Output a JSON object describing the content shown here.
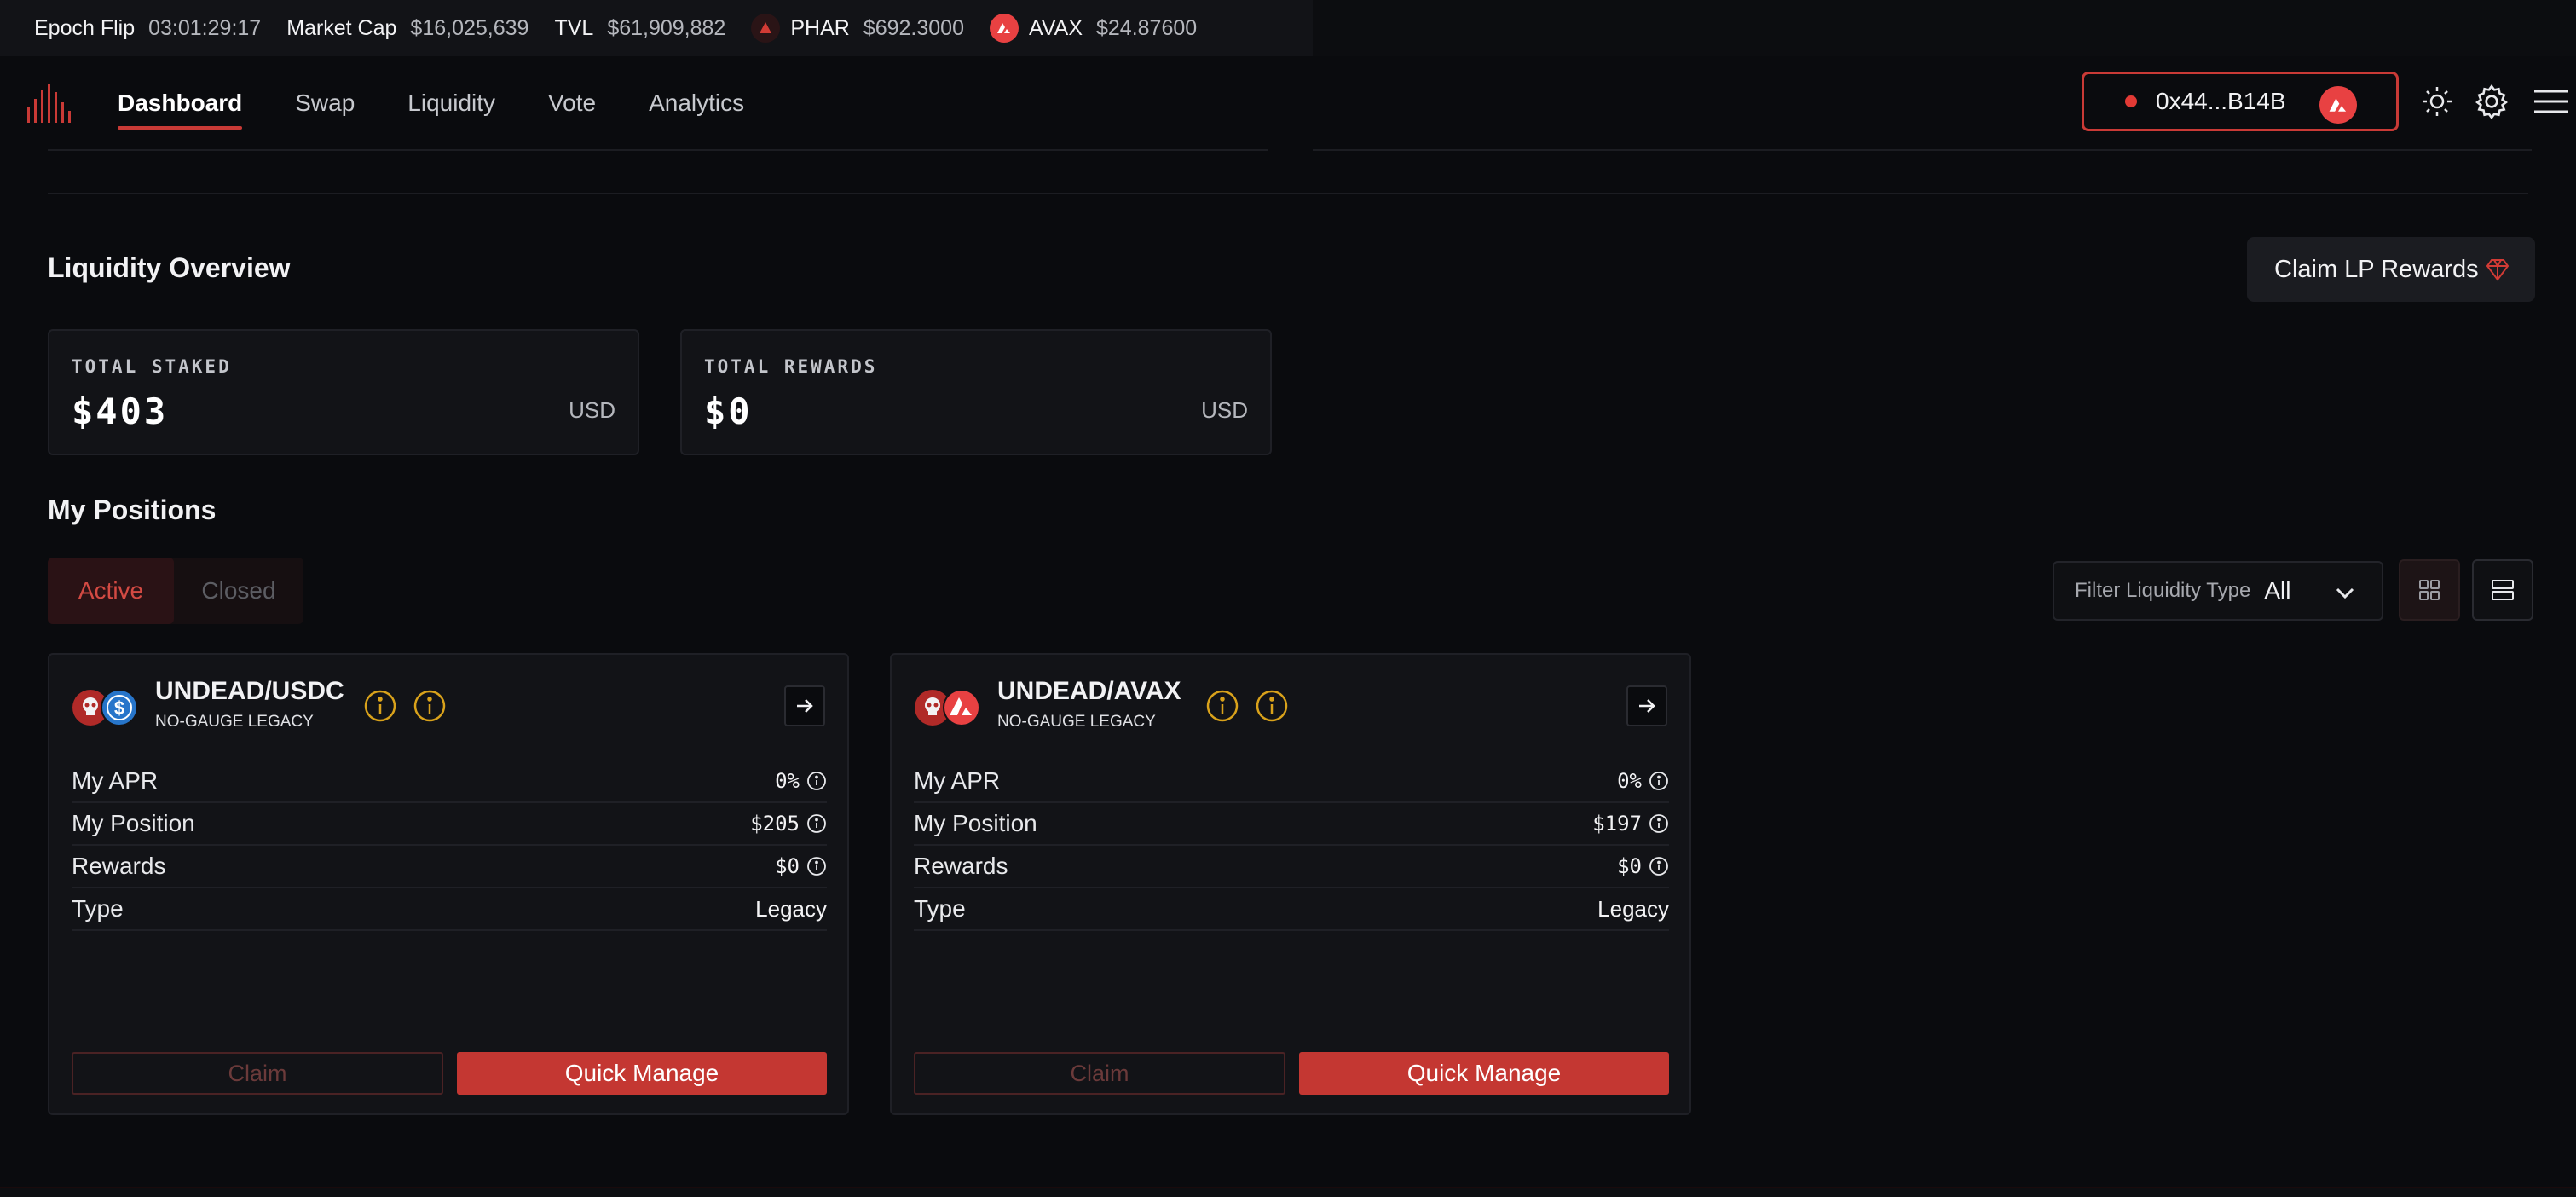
{
  "ticker": {
    "epoch_label": "Epoch Flip",
    "epoch_value": "03:01:29:17",
    "mcap_label": "Market Cap",
    "mcap_value": "$16,025,639",
    "tvl_label": "TVL",
    "tvl_value": "$61,909,882",
    "phar_label": "PHAR",
    "phar_value": "$692.3000",
    "avax_label": "AVAX",
    "avax_value": "$24.87600"
  },
  "nav": {
    "tabs": [
      "Dashboard",
      "Swap",
      "Liquidity",
      "Vote",
      "Analytics"
    ],
    "active_tab": "Dashboard",
    "wallet_address": "0x44...B14B"
  },
  "liquidity_overview": {
    "title": "Liquidity Overview",
    "claim_button": "Claim LP Rewards",
    "total_staked_label": "TOTAL STAKED",
    "total_staked_value": "$403",
    "total_staked_unit": "USD",
    "total_rewards_label": "TOTAL REWARDS",
    "total_rewards_value": "$0",
    "total_rewards_unit": "USD"
  },
  "positions": {
    "title": "My Positions",
    "tab_active": "Active",
    "tab_closed": "Closed",
    "filter_label": "Filter Liquidity Type",
    "filter_value": "All",
    "cards": [
      {
        "pair": "UNDEAD/USDC",
        "subtitle": "NO-GAUGE LEGACY",
        "apr_label": "My APR",
        "apr_value": "0%",
        "position_label": "My Position",
        "position_value": "$205",
        "rewards_label": "Rewards",
        "rewards_value": "$0",
        "type_label": "Type",
        "type_value": "Legacy",
        "claim_label": "Claim",
        "manage_label": "Quick Manage"
      },
      {
        "pair": "UNDEAD/AVAX",
        "subtitle": "NO-GAUGE LEGACY",
        "apr_label": "My APR",
        "apr_value": "0%",
        "position_label": "My Position",
        "position_value": "$197",
        "rewards_label": "Rewards",
        "rewards_value": "$0",
        "type_label": "Type",
        "type_value": "Legacy",
        "claim_label": "Claim",
        "manage_label": "Quick Manage"
      }
    ]
  },
  "colors": {
    "accent": "#c93a36",
    "background": "#0a0b0e",
    "card": "#121317",
    "warning": "#d9a21b"
  }
}
